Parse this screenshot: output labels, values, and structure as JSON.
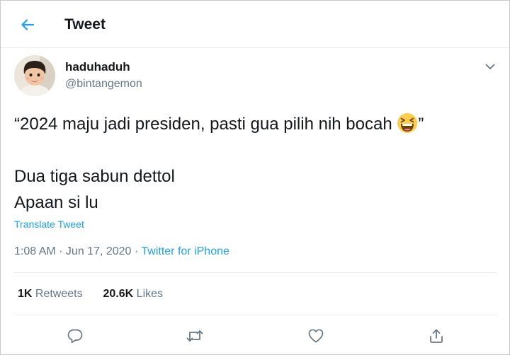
{
  "header": {
    "title": "Tweet"
  },
  "author": {
    "display_name": "haduhaduh",
    "handle": "@bintangemon"
  },
  "tweet": {
    "line1_text": "“2024 maju jadi presiden, pasti gua pilih nih bocah ",
    "line1_emoji": "laughing-face",
    "line1_close": "”",
    "line2": "Dua tiga sabun dettol",
    "line3": "Apaan si lu",
    "translate_label": "Translate Tweet"
  },
  "meta": {
    "time": "1:08 AM",
    "separator": " · ",
    "date": "Jun 17, 2020",
    "source": "Twitter for iPhone"
  },
  "stats": {
    "retweets_count": "1K",
    "retweets_label": "Retweets",
    "likes_count": "20.6K",
    "likes_label": "Likes"
  },
  "actions": [
    "reply-icon",
    "retweet-icon",
    "like-icon",
    "share-icon"
  ],
  "colors": {
    "accent": "#1da1f2",
    "text": "#14171a",
    "secondary": "#657786",
    "border": "#e6ecf0"
  }
}
